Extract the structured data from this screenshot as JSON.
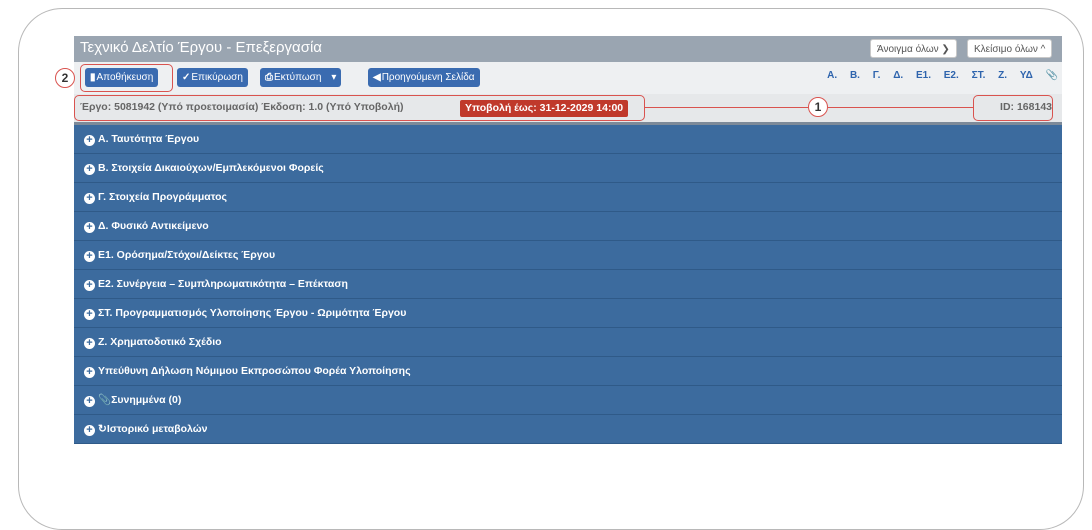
{
  "window": {
    "title": "Τεχνικό Δελτίο Έργου - Επεξεργασία",
    "expand_all": "Άνοιγμα όλων",
    "collapse_all": "Κλείσιμο όλων"
  },
  "toolbar": {
    "save": "Αποθήκευση",
    "validate": "Επικύρωση",
    "print": "Εκτύπωση",
    "previous_page": "Προηγούμενη Σελίδα",
    "section_links": [
      "Α.",
      "Β.",
      "Γ.",
      "Δ.",
      "Ε1.",
      "Ε2.",
      "ΣΤ.",
      "Ζ.",
      "ΥΔ"
    ]
  },
  "info": {
    "summary": "Έργο: 5081942  (Υπό προετοιμασία)   Έκδοση: 1.0  (Υπό Υποβολή)",
    "deadline": "Υποβολή έως: 31-12-2029 14:00",
    "id": "ID: 168143"
  },
  "callouts": [
    "1",
    "2"
  ],
  "sections": [
    "Α. Ταυτότητα Έργου",
    "Β. Στοιχεία Δικαιούχων/Εμπλεκόμενοι Φορείς",
    "Γ. Στοιχεία Προγράμματος",
    "Δ. Φυσικό Αντικείμενο",
    "Ε1. Ορόσημα/Στόχοι/Δείκτες Έργου",
    "Ε2. Συνέργεια – Συμπληρωματικότητα – Επέκταση",
    "ΣΤ. Προγραμματισμός Υλοποίησης Έργου - Ωριμότητα Έργου",
    "Ζ. Χρηματοδοτικό Σχέδιο",
    "Υπεύθυνη Δήλωση Νόμιμου Εκπροσώπου Φορέα Υλοποίησης",
    "Συνημμένα (0)",
    "Ιστορικό μεταβολών"
  ],
  "colors": {
    "section_bg": "#3c6b9e",
    "button_bg": "#3a6bb0",
    "deadline_bg": "#c0392b",
    "callout": "#d9534f"
  }
}
